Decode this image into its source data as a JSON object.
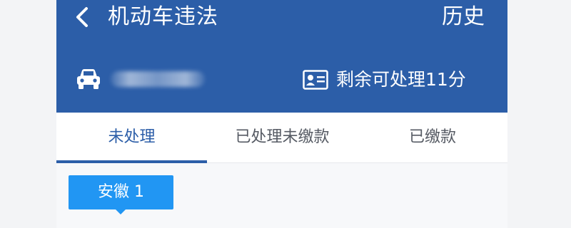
{
  "header": {
    "title": "机动车违法",
    "history_label": "历史",
    "points_text": "剩余可处理11分",
    "back_icon": "chevron-left-icon",
    "car_icon": "car-icon",
    "card_icon": "id-card-icon",
    "background_color": "#2c5ea8"
  },
  "tabs": [
    {
      "label": "未处理",
      "active": true
    },
    {
      "label": "已处理未缴款",
      "active": false
    },
    {
      "label": "已缴款",
      "active": false
    }
  ],
  "region_tag": {
    "label": "安徽 1",
    "color": "#2196f3"
  }
}
